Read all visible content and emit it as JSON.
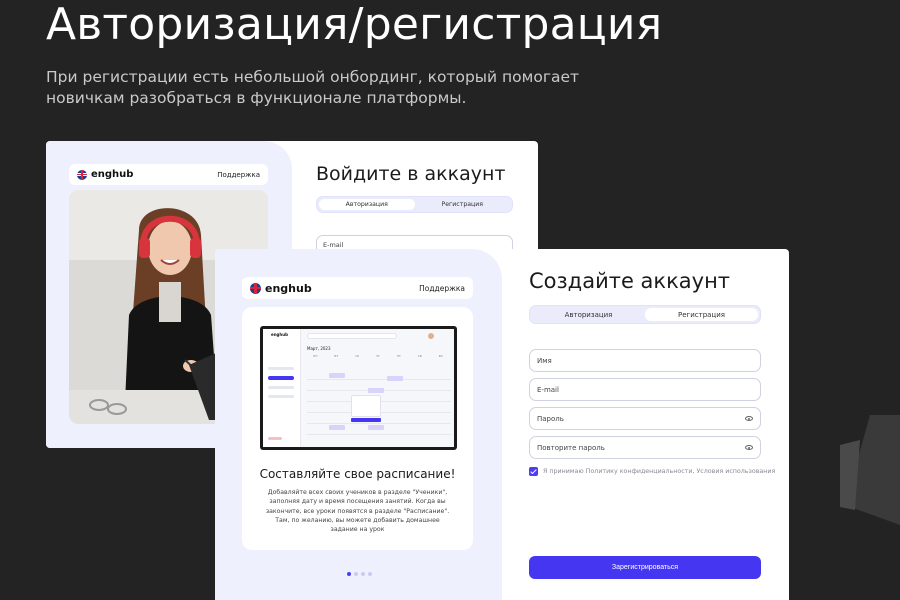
{
  "hero": {
    "title": "Авторизация/регистрация",
    "subtitle_line1": "При регистрации есть небольшой онбординг, который помогает",
    "subtitle_line2": "новичкам разобраться в функционале платформы."
  },
  "brand": {
    "name": "enghub",
    "support": "Поддержка"
  },
  "login": {
    "title": "Войдите в аккаунт",
    "tabs": [
      "Авторизация",
      "Регистрация"
    ],
    "email_placeholder": "E-mail"
  },
  "signup": {
    "title": "Создайте аккаунт",
    "tabs": [
      "Авторизация",
      "Регистрация"
    ],
    "fields": {
      "name": "Имя",
      "email": "E-mail",
      "password": "Пароль",
      "repeat_password": "Повторите пароль"
    },
    "consent": "Я принимаю Политику конфиденциальности, Условия использования",
    "submit": "Зарегистрироваться"
  },
  "onboarding": {
    "title": "Составляйте свое расписание!",
    "text": "Добавляйте всех своих учеников в разделе \"Ученики\", заполняя дату и время посещения занятий. Когда вы закончите, все уроки появятся в разделе \"Расписание\". Там, по желанию, вы можете добавить домашнее задание на урок",
    "mock": {
      "brand": "enghub",
      "month": "Март, 2023",
      "days": [
        "ПН",
        "ВТ",
        "СР",
        "ЧТ",
        "ПТ",
        "СБ",
        "ВС"
      ]
    },
    "pages_total": 4,
    "current_page": 1
  },
  "colors": {
    "accent": "#4536f2",
    "background": "#232323",
    "pane": "#eef0fd"
  }
}
